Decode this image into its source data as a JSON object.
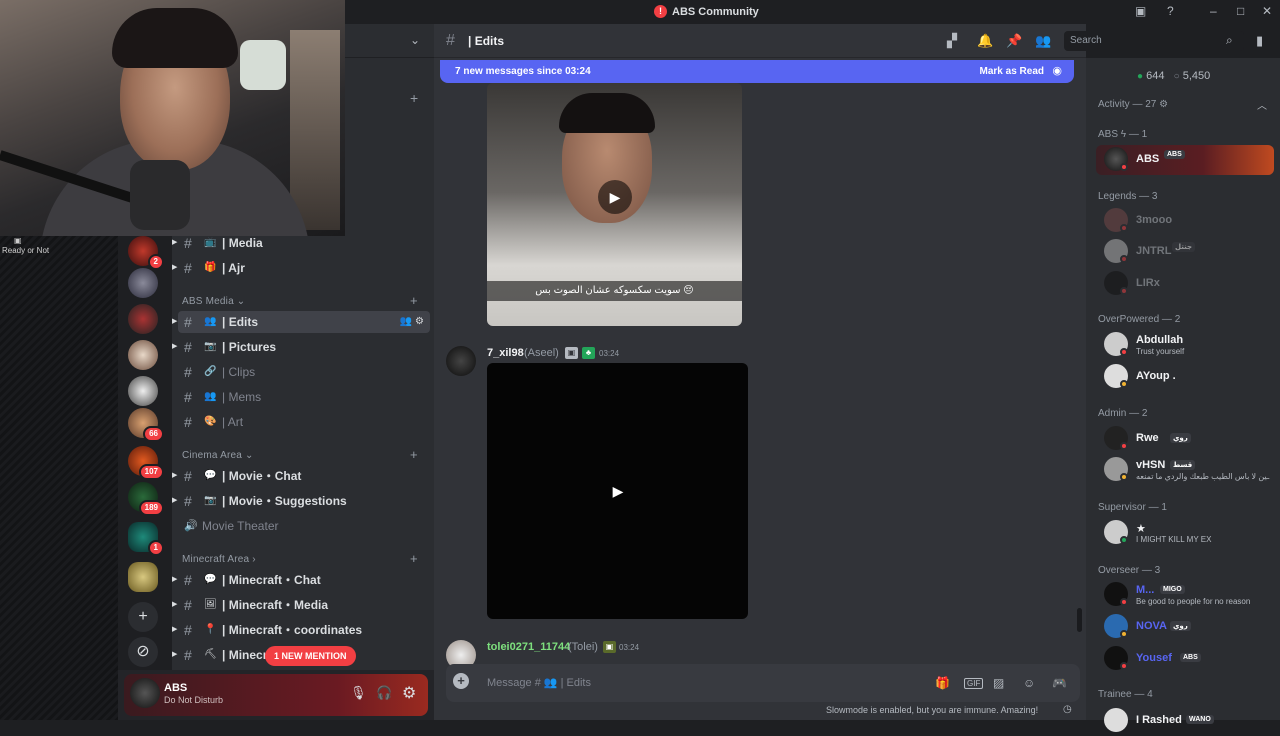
{
  "window": {
    "title": "ABS Community"
  },
  "stream": {
    "ready_label": "Ready or Not"
  },
  "rail": {
    "badges": [
      "2",
      "66",
      "107",
      "189",
      "1"
    ]
  },
  "categories": {
    "media": "ABS Media",
    "cinema": "Cinema Area",
    "minecraft": "Minecraft Area"
  },
  "channels": [
    {
      "name": "| Media",
      "emoji": "📺"
    },
    {
      "name": "| Ajr",
      "emoji": "🎁"
    },
    {
      "name": "| Edits",
      "emoji": "👥"
    },
    {
      "name": "| Pictures",
      "emoji": "📷"
    },
    {
      "name": "| Clips",
      "emoji": "🔗"
    },
    {
      "name": "| Mems",
      "emoji": "👥"
    },
    {
      "name": "| Art",
      "emoji": "🎨"
    },
    {
      "name": "| Movie・Chat",
      "emoji": "💬"
    },
    {
      "name": "| Movie・Suggestions",
      "emoji": "📷"
    },
    {
      "name": "Movie Theater",
      "emoji": "🔊"
    },
    {
      "name": "| Minecraft・Chat",
      "emoji": "💬"
    },
    {
      "name": "| Minecraft・Media",
      "emoji": "🖼"
    },
    {
      "name": "| Minecraft・coordinates",
      "emoji": "📍"
    },
    {
      "name": "| Minecr",
      "emoji": "⛏"
    }
  ],
  "mention_pill": "1 NEW MENTION",
  "user": {
    "name": "ABS",
    "status": "Do Not Disturb"
  },
  "chat": {
    "channel_name": "| Edits",
    "new_messages": "7 new messages since 03:24",
    "mark_read": "Mark as Read",
    "video_caption": "سويت سكسوكه عشان الصوت بس 😔",
    "messages": [
      {
        "name": "7_xil98",
        "extra": "(Aseel)",
        "time": "03:24"
      },
      {
        "name": "tolei0271_11744",
        "extra": "(Tolei)",
        "time": "03:24"
      }
    ],
    "composer_placeholder": "Message # 👥 | Edits",
    "slowmode": "Slowmode is enabled, but you are immune. Amazing!"
  },
  "search": {
    "placeholder": "Search"
  },
  "members": {
    "online": "644",
    "total": "5,450",
    "activity": "Activity — 27",
    "groups": [
      {
        "label": "ABS ϟ — 1"
      },
      {
        "label": "Legends — 3"
      },
      {
        "label": "OverPowered — 2"
      },
      {
        "label": "Admin — 2"
      },
      {
        "label": "Supervisor — 1"
      },
      {
        "label": "Overseer — 3"
      },
      {
        "label": "Trainee — 4"
      }
    ],
    "list": [
      {
        "name": "ABS",
        "tag": "ABS",
        "color": "#f2f3f5",
        "sub": ""
      },
      {
        "name": "3mooo",
        "tag": "",
        "color": "#4e5058",
        "sub": ""
      },
      {
        "name": "JNTRL",
        "tag": "جنتل",
        "color": "#4e5058",
        "sub": ""
      },
      {
        "name": "LIRx",
        "tag": "",
        "color": "#4e5058",
        "sub": ""
      },
      {
        "name": "Abdullah",
        "tag": "",
        "color": "#f2f3f5",
        "sub": "Trust yourself"
      },
      {
        "name": "AYoup .",
        "tag": "",
        "color": "#f2f3f5",
        "sub": ""
      },
      {
        "name": "Rwe",
        "tag": "روي",
        "color": "#f2f3f5",
        "sub": ""
      },
      {
        "name": "vHSN",
        "tag": "قسط",
        "color": "#f2f3f5",
        "sub": "ـين لا باس الطيب طبعك والردي ما تمنعه"
      },
      {
        "name": "★",
        "tag": "",
        "color": "#f2f3f5",
        "sub": "I MIGHT KILL MY EX"
      },
      {
        "name": "M...",
        "tag": "MIGO",
        "color": "#5865f2",
        "sub": "Be good to people for no reason"
      },
      {
        "name": "NOVA",
        "tag": "روي",
        "color": "#5865f2",
        "sub": ""
      },
      {
        "name": "Yousef",
        "tag": "ABS",
        "color": "#5865f2",
        "sub": ""
      },
      {
        "name": "I Rashed",
        "tag": "WANO",
        "color": "#f2f3f5",
        "sub": ""
      }
    ]
  }
}
